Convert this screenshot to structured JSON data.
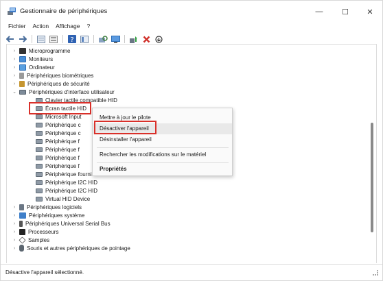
{
  "window": {
    "title": "Gestionnaire de périphériques",
    "minimize_glyph": "—",
    "maximize_glyph": "☐",
    "close_glyph": "✕"
  },
  "menubar": {
    "items": [
      "Fichier",
      "Action",
      "Affichage",
      "?"
    ]
  },
  "toolbar": {
    "icons": [
      "back-arrow-icon",
      "forward-arrow-icon",
      "properties-icon",
      "list-view-icon",
      "help-icon",
      "view-icon",
      "scan-hardware-icon",
      "monitor-icon",
      "update-driver-icon",
      "uninstall-icon",
      "enable-device-icon"
    ]
  },
  "tree": {
    "top_nodes": [
      {
        "label": "Microprogramme",
        "icon": "chip-icon",
        "expanded": false
      },
      {
        "label": "Moniteurs",
        "icon": "monitor-icon",
        "expanded": false
      },
      {
        "label": "Ordinateur",
        "icon": "computer-icon",
        "expanded": false
      },
      {
        "label": "Périphériques biométriques",
        "icon": "biometric-icon",
        "expanded": false
      },
      {
        "label": "Périphériques de sécurité",
        "icon": "security-icon",
        "expanded": false
      },
      {
        "label": "Périphériques d'interface utilisateur",
        "icon": "hid-icon",
        "expanded": true
      }
    ],
    "hid_children": [
      "Clavier tactile compatible HID",
      "Écran tactile HID",
      "Microsoft Input Configuration Device",
      "Périphérique conforme aux normes HID",
      "Périphérique conforme aux normes HID",
      "Périphérique fournisseur HID",
      "Périphérique fournisseur HID",
      "Périphérique fournisseur HID",
      "Périphérique fournisseur HID",
      "Périphérique fournisseur HID",
      "Périphérique I2C HID",
      "Périphérique I2C HID",
      "Virtual HID Device"
    ],
    "hid_children_visible_text": [
      "Clavier tactile compatible HID",
      "Écran tactile HID",
      "Microsoft Input",
      "Périphérique c",
      "Périphérique c",
      "Périphérique f",
      "Périphérique f",
      "Périphérique f",
      "Périphérique f",
      "Périphérique fournisseur HID",
      "Périphérique I2C HID",
      "Périphérique I2C HID",
      "Virtual HID Device"
    ],
    "bottom_nodes": [
      {
        "label": "Périphériques logiciels",
        "icon": "software-device-icon"
      },
      {
        "label": "Périphériques système",
        "icon": "system-device-icon"
      },
      {
        "label": "Périphériques Universal Serial Bus",
        "icon": "usb-icon"
      },
      {
        "label": "Processeurs",
        "icon": "processor-icon"
      },
      {
        "label": "Samples",
        "icon": "sample-icon"
      },
      {
        "label": "Souris et autres périphériques de pointage",
        "icon": "mouse-icon"
      }
    ],
    "selected_item": "Écran tactile HID"
  },
  "context_menu": {
    "items": [
      {
        "label": "Mettre à jour le pilote",
        "bold": false
      },
      {
        "label": "Désactiver l'appareil",
        "bold": false,
        "hovered": true
      },
      {
        "label": "Désinstaller l'appareil",
        "bold": false
      },
      {
        "label": "Rechercher les modifications sur le matériel",
        "bold": false
      },
      {
        "label": "Propriétés",
        "bold": true
      }
    ]
  },
  "statusbar": {
    "text": "Désactive l'appareil sélectionné."
  },
  "colors": {
    "highlight_border": "#d9302a",
    "hover_bg": "#e9e9e9",
    "accent": "#3a6db5"
  }
}
